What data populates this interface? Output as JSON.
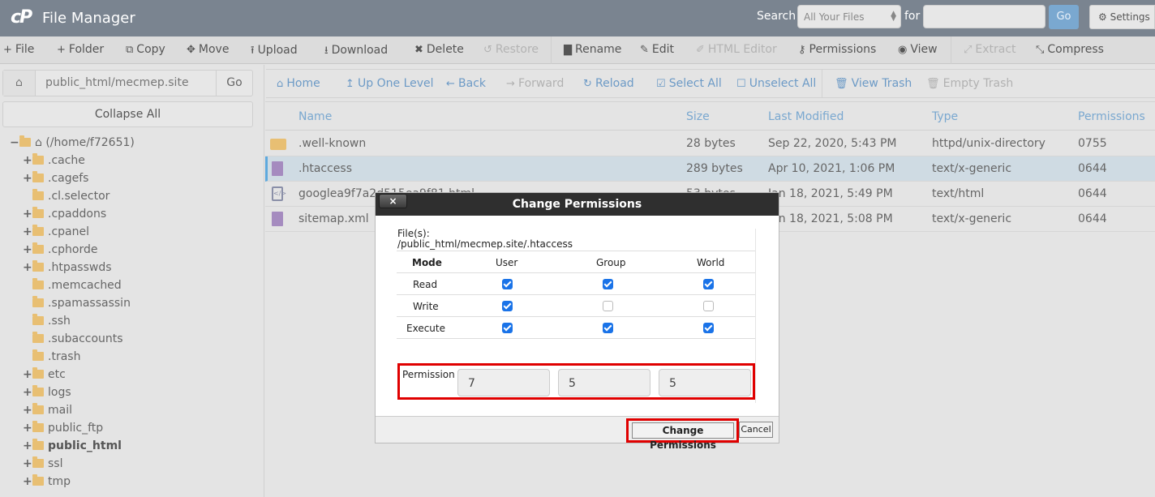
{
  "header": {
    "logo": "cP",
    "title": "File Manager",
    "search_label": "Search",
    "search_scope": "All Your Files",
    "for_label": "for",
    "search_value": "",
    "go_label": "Go",
    "settings_label": "Settings"
  },
  "toolbar": [
    {
      "label": "File",
      "icon": "plus-icon",
      "glyph": "+",
      "disabled": false
    },
    {
      "label": "Folder",
      "icon": "plus-icon",
      "glyph": "+",
      "disabled": false
    },
    {
      "label": "Copy",
      "icon": "copy-icon",
      "glyph": "⧉",
      "disabled": false
    },
    {
      "label": "Move",
      "icon": "move-icon",
      "glyph": "✥",
      "disabled": false
    },
    {
      "label": "Upload",
      "icon": "upload-icon",
      "glyph": "⭱",
      "disabled": false
    },
    {
      "label": "Download",
      "icon": "download-icon",
      "glyph": "⭳",
      "disabled": false
    },
    {
      "label": "Delete",
      "icon": "delete-icon",
      "glyph": "✖",
      "disabled": false
    },
    {
      "label": "Restore",
      "icon": "restore-icon",
      "glyph": "↺",
      "disabled": true
    },
    {
      "label": "Rename",
      "icon": "file-icon",
      "glyph": "▇",
      "disabled": false
    },
    {
      "label": "Edit",
      "icon": "pencil-icon",
      "glyph": "✎",
      "disabled": false
    },
    {
      "label": "HTML Editor",
      "icon": "html-editor-icon",
      "glyph": "✐",
      "disabled": true
    },
    {
      "label": "Permissions",
      "icon": "key-icon",
      "glyph": "⚷",
      "disabled": false
    },
    {
      "label": "View",
      "icon": "eye-icon",
      "glyph": "◉",
      "disabled": false
    },
    {
      "label": "Extract",
      "icon": "expand-icon",
      "glyph": "⤢",
      "disabled": true
    },
    {
      "label": "Compress",
      "icon": "compress-icon",
      "glyph": "⤡",
      "disabled": false
    }
  ],
  "sidebar": {
    "path_value": "public_html/mecmep.site",
    "go_label": "Go",
    "collapse_label": "Collapse All",
    "root_label": "(/home/f72651)",
    "tree": [
      {
        "label": ".cache",
        "expandable": true,
        "bold": false
      },
      {
        "label": ".cagefs",
        "expandable": true,
        "bold": false
      },
      {
        "label": ".cl.selector",
        "expandable": false,
        "bold": false
      },
      {
        "label": ".cpaddons",
        "expandable": true,
        "bold": false
      },
      {
        "label": ".cpanel",
        "expandable": true,
        "bold": false
      },
      {
        "label": ".cphorde",
        "expandable": true,
        "bold": false
      },
      {
        "label": ".htpasswds",
        "expandable": true,
        "bold": false
      },
      {
        "label": ".memcached",
        "expandable": false,
        "bold": false
      },
      {
        "label": ".spamassassin",
        "expandable": false,
        "bold": false
      },
      {
        "label": ".ssh",
        "expandable": false,
        "bold": false
      },
      {
        "label": ".subaccounts",
        "expandable": false,
        "bold": false
      },
      {
        "label": ".trash",
        "expandable": false,
        "bold": false
      },
      {
        "label": "etc",
        "expandable": true,
        "bold": false
      },
      {
        "label": "logs",
        "expandable": true,
        "bold": false
      },
      {
        "label": "mail",
        "expandable": true,
        "bold": false
      },
      {
        "label": "public_ftp",
        "expandable": true,
        "bold": false
      },
      {
        "label": "public_html",
        "expandable": true,
        "bold": true
      },
      {
        "label": "ssl",
        "expandable": true,
        "bold": false
      },
      {
        "label": "tmp",
        "expandable": true,
        "bold": false
      }
    ]
  },
  "navbar": [
    {
      "label": "Home",
      "glyph": "⌂",
      "icon": "home-icon",
      "disabled": false
    },
    {
      "label": "Up One Level",
      "glyph": "↥",
      "icon": "up-level-icon",
      "disabled": false
    },
    {
      "label": "Back",
      "glyph": "←",
      "icon": "back-arrow-icon",
      "disabled": false
    },
    {
      "label": "Forward",
      "glyph": "→",
      "icon": "forward-arrow-icon",
      "disabled": true
    },
    {
      "label": "Reload",
      "glyph": "↻",
      "icon": "reload-icon",
      "disabled": false
    },
    {
      "label": "Select All",
      "glyph": "☑",
      "icon": "checkbox-checked-icon",
      "disabled": false
    },
    {
      "label": "Unselect All",
      "glyph": "☐",
      "icon": "checkbox-empty-icon",
      "disabled": false
    },
    {
      "label": "View Trash",
      "glyph": "🗑",
      "icon": "trash-icon",
      "disabled": false
    },
    {
      "label": "Empty Trash",
      "glyph": "🗑",
      "icon": "trash-icon",
      "disabled": true
    }
  ],
  "table": {
    "columns": [
      "Name",
      "Size",
      "Last Modified",
      "Type",
      "Permissions"
    ],
    "rows": [
      {
        "icon": "folder",
        "name": ".well-known",
        "size": "28 bytes",
        "modified": "Sep 22, 2020, 5:43 PM",
        "type": "httpd/unix-directory",
        "perms": "0755",
        "selected": false
      },
      {
        "icon": "text",
        "name": ".htaccess",
        "size": "289 bytes",
        "modified": "Apr 10, 2021, 1:06 PM",
        "type": "text/x-generic",
        "perms": "0644",
        "selected": true
      },
      {
        "icon": "html",
        "name": "googlea9f7a2d515ea9f81.html",
        "size": "53 bytes",
        "modified": "Jan 18, 2021, 5:49 PM",
        "type": "text/html",
        "perms": "0644",
        "selected": false
      },
      {
        "icon": "text",
        "name": "sitemap.xml",
        "size": "",
        "modified": "Jan 18, 2021, 5:08 PM",
        "type": "text/x-generic",
        "perms": "0644",
        "selected": false
      }
    ]
  },
  "dialog": {
    "title": "Change Permissions",
    "close_label": "×",
    "files_label": "File(s):",
    "file_path": "/public_html/mecmep.site/.htaccess",
    "header": [
      "Mode",
      "User",
      "Group",
      "World"
    ],
    "modes": [
      {
        "label": "Read",
        "user": true,
        "group": true,
        "world": true
      },
      {
        "label": "Write",
        "user": true,
        "group": false,
        "world": false
      },
      {
        "label": "Execute",
        "user": true,
        "group": true,
        "world": true
      }
    ],
    "permission_label": "Permission",
    "permission_values": [
      "7",
      "5",
      "5"
    ],
    "submit_label": "Change Permissions",
    "cancel_label": "Cancel",
    "highlight_color": "#e00000"
  }
}
